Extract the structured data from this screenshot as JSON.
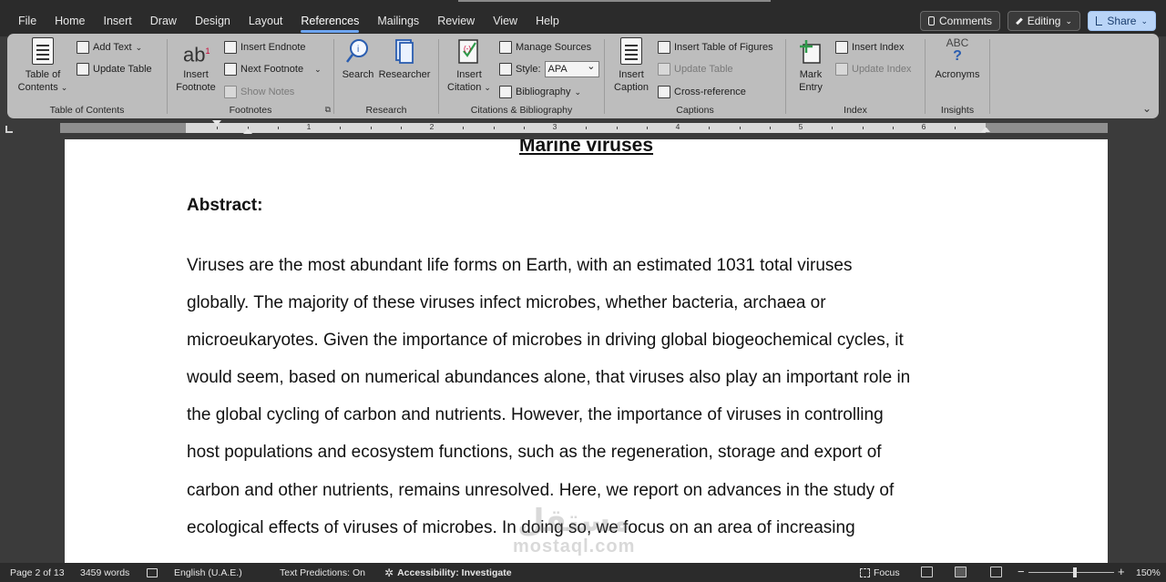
{
  "menu": {
    "tabs": [
      "File",
      "Home",
      "Insert",
      "Draw",
      "Design",
      "Layout",
      "References",
      "Mailings",
      "Review",
      "View",
      "Help"
    ],
    "active_tab": "References",
    "comments_label": "Comments",
    "editing_label": "Editing",
    "share_label": "Share"
  },
  "ribbon": {
    "toc": {
      "table_of_contents_line1": "Table of",
      "table_of_contents_line2": "Contents",
      "add_text": "Add Text",
      "update_table": "Update Table",
      "group_label": "Table of Contents"
    },
    "footnotes": {
      "insert_footnote_line1": "Insert",
      "insert_footnote_line2": "Footnote",
      "insert_endnote": "Insert Endnote",
      "next_footnote": "Next Footnote",
      "show_notes": "Show Notes",
      "group_label": "Footnotes"
    },
    "research": {
      "search": "Search",
      "researcher": "Researcher",
      "group_label": "Research"
    },
    "citations": {
      "insert_citation_line1": "Insert",
      "insert_citation_line2": "Citation",
      "manage_sources": "Manage Sources",
      "style_label": "Style:",
      "style_value": "APA",
      "bibliography": "Bibliography",
      "group_label": "Citations & Bibliography"
    },
    "captions": {
      "insert_caption_line1": "Insert",
      "insert_caption_line2": "Caption",
      "insert_table_of_figures": "Insert Table of Figures",
      "update_table": "Update Table",
      "cross_reference": "Cross-reference",
      "group_label": "Captions"
    },
    "index": {
      "mark_entry_line1": "Mark",
      "mark_entry_line2": "Entry",
      "insert_index": "Insert Index",
      "update_index": "Update Index",
      "group_label": "Index"
    },
    "insights": {
      "abc": "ABC",
      "question": "?",
      "acronyms": "Acronyms",
      "group_label": "Insights"
    }
  },
  "ruler": {
    "numbers": [
      "1",
      "2",
      "3",
      "4",
      "5",
      "6"
    ]
  },
  "document": {
    "title": "Marine viruses",
    "abstract_heading": "Abstract:",
    "lines": [
      "Viruses are the most abundant life forms on Earth, with an estimated 1031 total viruses",
      "globally. The majority of these viruses infect microbes, whether bacteria, archaea or",
      "microeukaryotes. Given the importance of microbes in driving global biogeochemical cycles, it",
      "would seem, based on numerical abundances alone, that viruses also play an important role in",
      "the global cycling of carbon and nutrients. However, the importance of viruses in controlling",
      "host populations and ecosystem functions, such as the regeneration, storage and export of",
      "carbon and other nutrients, remains unresolved. Here, we report on advances in the study of",
      "ecological effects of viruses of microbes. In doing so, we focus on an area of increasing"
    ],
    "watermark_line1": "مستقل",
    "watermark_line2": "mostaql.com"
  },
  "status": {
    "page": "Page 2 of 13",
    "words": "3459 words",
    "language": "English (U.A.E.)",
    "text_predictions": "Text Predictions: On",
    "accessibility": "Accessibility: Investigate",
    "focus": "Focus",
    "zoom": "150%",
    "zoom_minus": "−",
    "zoom_plus": "+"
  }
}
